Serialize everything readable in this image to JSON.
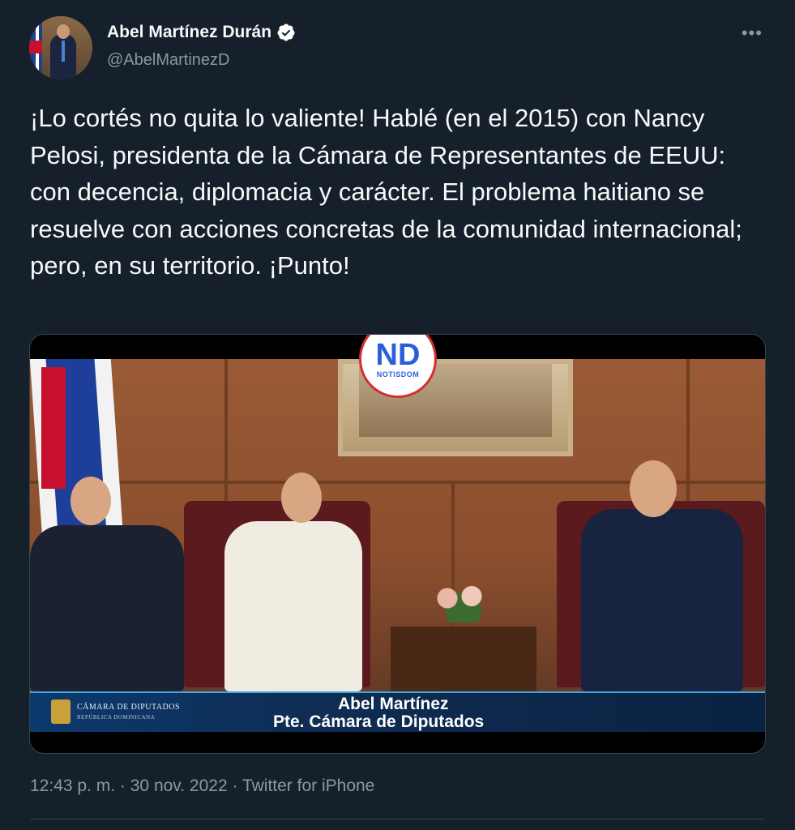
{
  "author": {
    "display_name": "Abel Martínez Durán",
    "handle": "@AbelMartinezD",
    "verified": true
  },
  "tweet": {
    "text": "¡Lo cortés no quita lo valiente! Hablé (en el 2015) con Nancy Pelosi, presidenta de la Cámara de Representantes de EEUU: con decencia, diplomacia y carácter. El problema haitiano se resuelve con acciones concretas de la comunidad internacional; pero, en su territorio. ¡Punto!"
  },
  "media": {
    "watermark_letters": "ND",
    "watermark_word": "NOTISDOM",
    "lower_third_institution": "CÁMARA DE DIPUTADOS",
    "lower_third_institution_sub": "REPÚBLICA DOMINICANA",
    "lower_third_name": "Abel Martínez",
    "lower_third_title": "Pte. Cámara de Diputados"
  },
  "meta": {
    "time": "12:43 p. m.",
    "separator": "·",
    "date": "30 nov. 2022",
    "source": "Twitter for iPhone"
  },
  "more_icon": "ellipsis-icon",
  "colors": {
    "background": "#15202b",
    "text": "#f7f9f9",
    "secondary": "#8b98a5",
    "verified_badge": "#ffffff"
  }
}
